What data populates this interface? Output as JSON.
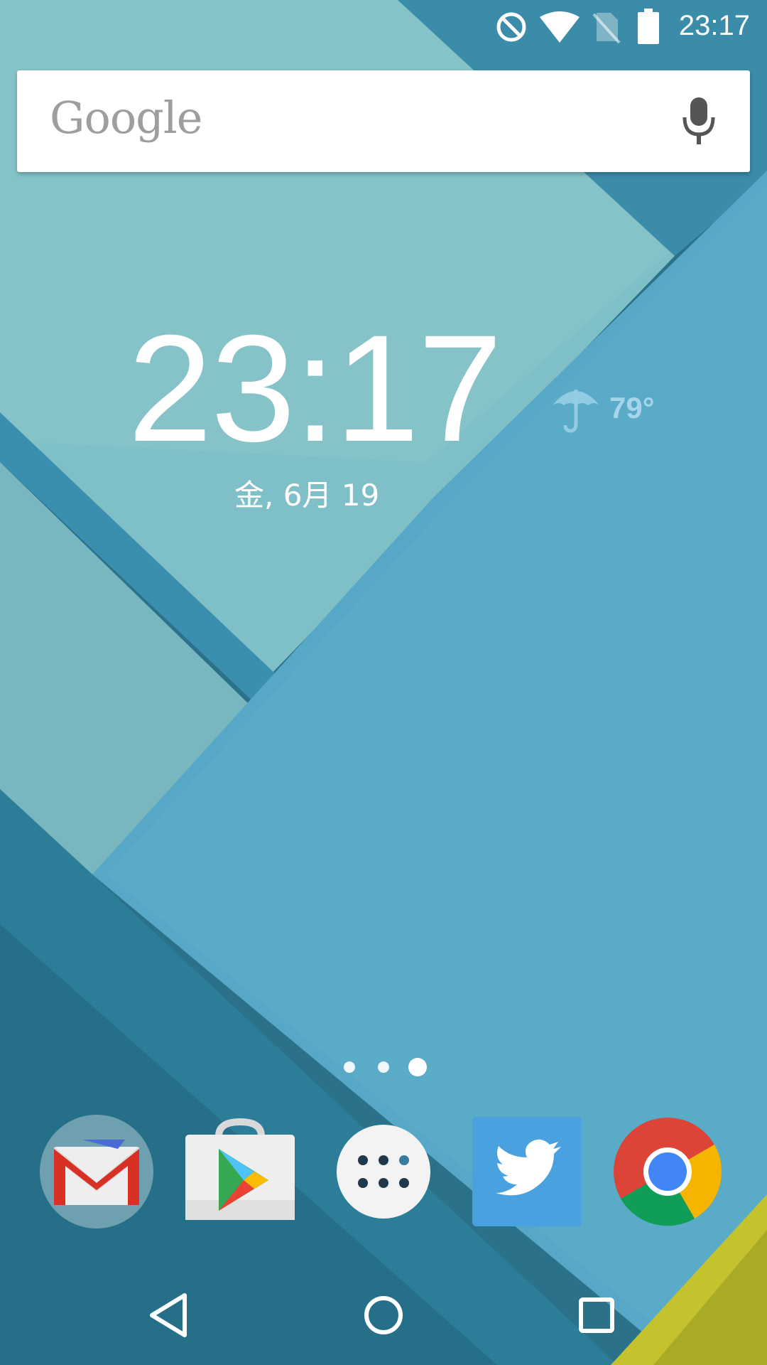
{
  "status_bar": {
    "time": "23:17",
    "icons": [
      "do-not-disturb-icon",
      "wifi-icon",
      "no-sim-icon",
      "battery-icon"
    ]
  },
  "search_bar": {
    "logo_text": "Google",
    "mic_icon": "mic-icon"
  },
  "clock_widget": {
    "time": "23:17",
    "date": "金, 6月 19"
  },
  "weather": {
    "icon": "umbrella-icon",
    "temperature": "79°"
  },
  "page_indicator": {
    "total_pages": 3,
    "active_index": 2
  },
  "dock": {
    "apps": [
      {
        "name": "Gmail",
        "icon": "gmail-icon"
      },
      {
        "name": "Play Store",
        "icon": "play-store-icon"
      },
      {
        "name": "All apps",
        "icon": "app-drawer-icon"
      },
      {
        "name": "Twitter",
        "icon": "twitter-icon"
      },
      {
        "name": "Chrome",
        "icon": "chrome-icon"
      }
    ]
  },
  "nav_bar": {
    "buttons": [
      "back-icon",
      "home-icon",
      "recents-icon"
    ]
  },
  "colors": {
    "wallpaper_light": "#8fc8cc",
    "wallpaper_mid": "#5aaac6",
    "wallpaper_dark": "#2a7189",
    "accent_yellow": "#c7c52a"
  }
}
